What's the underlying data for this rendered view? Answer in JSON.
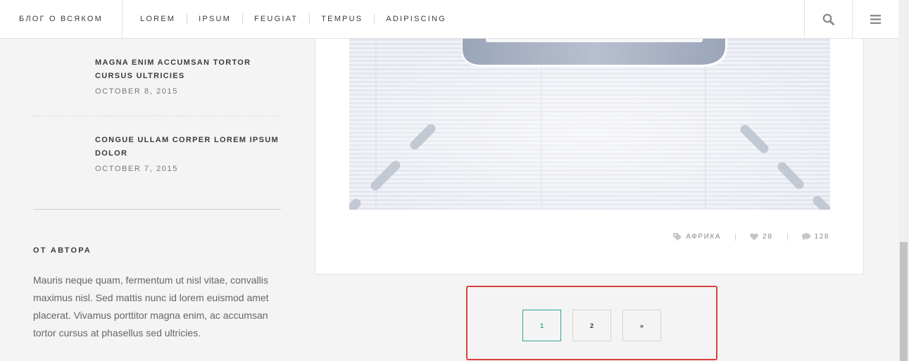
{
  "header": {
    "brand": "БЛОГ О ВСЯКОМ",
    "nav": [
      "LOREM",
      "IPSUM",
      "FEUGIAT",
      "TEMPUS",
      "ADIPISCING"
    ],
    "search_icon": "search-icon",
    "menu_icon": "hamburger-menu-icon"
  },
  "sidebar": {
    "posts": [
      {
        "title": "MAGNA ENIM ACCUMSAN TORTOR CURSUS ULTRICIES",
        "date": "OCTOBER 8, 2015"
      },
      {
        "title": "CONGUE ULLAM CORPER LOREM IPSUM DOLOR",
        "date": "OCTOBER 7, 2015"
      }
    ],
    "about": {
      "title": "ОТ АВТОРА",
      "text": "Mauris neque quam, fermentum ut nisl vitae, convallis maximus nisl. Sed mattis nunc id lorem euismod amet placerat. Vivamus porttitor magna enim, ac accumsan tortor cursus at phasellus sed ultricies."
    }
  },
  "article": {
    "meta": {
      "category": "АФРИКА",
      "likes": "28",
      "comments": "128"
    }
  },
  "pagination": {
    "pages": [
      "1",
      "2"
    ],
    "next": "»",
    "current": "1"
  },
  "colors": {
    "accent": "#2ea39a",
    "highlight_outline": "#d8403b",
    "background": "#f4f4f4"
  }
}
